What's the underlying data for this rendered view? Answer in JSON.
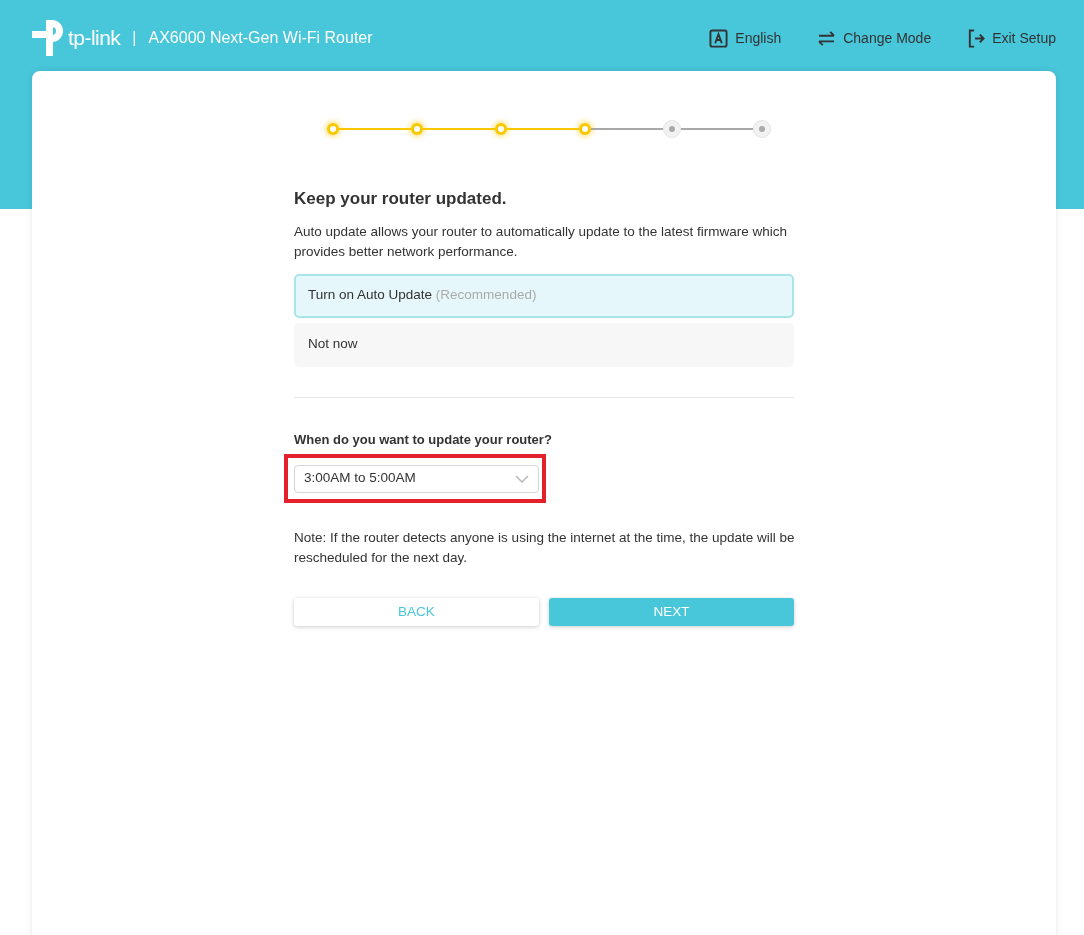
{
  "header": {
    "logo_text": "tp-link",
    "product": "AX6000 Next-Gen Wi-Fi Router",
    "separator": "|",
    "actions": [
      {
        "kind": "language",
        "label": "English"
      },
      {
        "kind": "mode",
        "label": "Change Mode"
      },
      {
        "kind": "exit",
        "label": "Exit Setup"
      }
    ]
  },
  "steps": [
    {
      "completed": true
    },
    {
      "completed": true
    },
    {
      "completed": true
    },
    {
      "completed": true
    },
    {
      "completed": false
    },
    {
      "completed": false
    }
  ],
  "title": "Keep your router updated.",
  "description": "Auto update allows your router to automatically update to the latest firmware which provides better network performance.",
  "options": [
    {
      "label": "Turn on Auto Update",
      "hint": "(Recommended)",
      "selected": true
    },
    {
      "label": "Not now",
      "selected": false
    }
  ],
  "schedule": {
    "question": "When do you want to update your router?",
    "value": "3:00AM to 5:00AM"
  },
  "note": "Note: If the router detects anyone is using the internet at the time, the update will be rescheduled for the next day.",
  "buttons": {
    "back": "BACK",
    "next": "NEXT"
  }
}
